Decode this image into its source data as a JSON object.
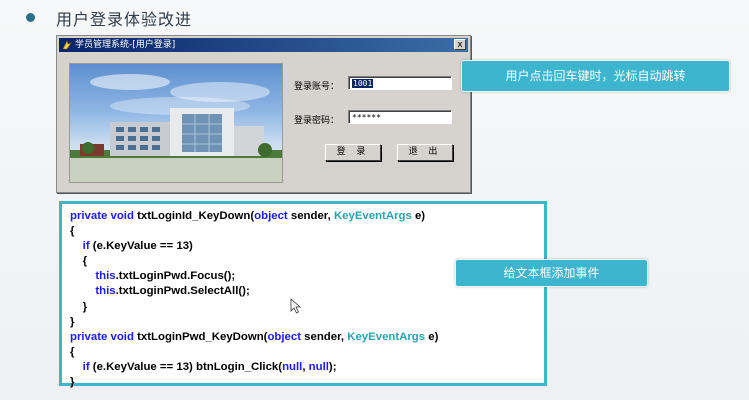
{
  "slide": {
    "title": "用户登录体验改进"
  },
  "login_window": {
    "title": "学员管理系统-[用户登录]",
    "close_glyph": "x",
    "fields": {
      "account": {
        "label": "登录账号：",
        "value": "1001"
      },
      "password": {
        "label": "登录密码：",
        "value": "******"
      }
    },
    "buttons": {
      "login": "登 录",
      "exit": "退 出"
    }
  },
  "callouts": {
    "enter_jump": "用户点击回车键时，光标自动跳转",
    "add_event": "给文本框添加事件"
  },
  "code": {
    "l1": {
      "a": "private void",
      "b": " txtLoginId_KeyDown(",
      "c": "object",
      "d": " sender, ",
      "e": "KeyEventArgs",
      "f": " e)"
    },
    "l2": "{",
    "l3": {
      "a": "    if",
      "b": " (e.KeyValue == 13)"
    },
    "l4": "    {",
    "l5": {
      "a": "        this",
      "b": ".txtLoginPwd.Focus();"
    },
    "l6": {
      "a": "        this",
      "b": ".txtLoginPwd.SelectAll();"
    },
    "l7": "    }",
    "l8": "}",
    "l9": {
      "a": "private void",
      "b": " txtLoginPwd_KeyDown(",
      "c": "object",
      "d": " sender, ",
      "e": "KeyEventArgs",
      "f": " e)"
    },
    "l10": "{",
    "l11": {
      "a": "    if",
      "b": " (e.KeyValue == 13) btnLogin_Click(",
      "c": "null",
      "d": ", ",
      "e": "null",
      "f": ");"
    },
    "l12": "}"
  },
  "colors": {
    "accent": "#3eb5cf",
    "keyword": "#1a1aff",
    "type": "#2aa3b0",
    "window_title": "#0a246a"
  }
}
